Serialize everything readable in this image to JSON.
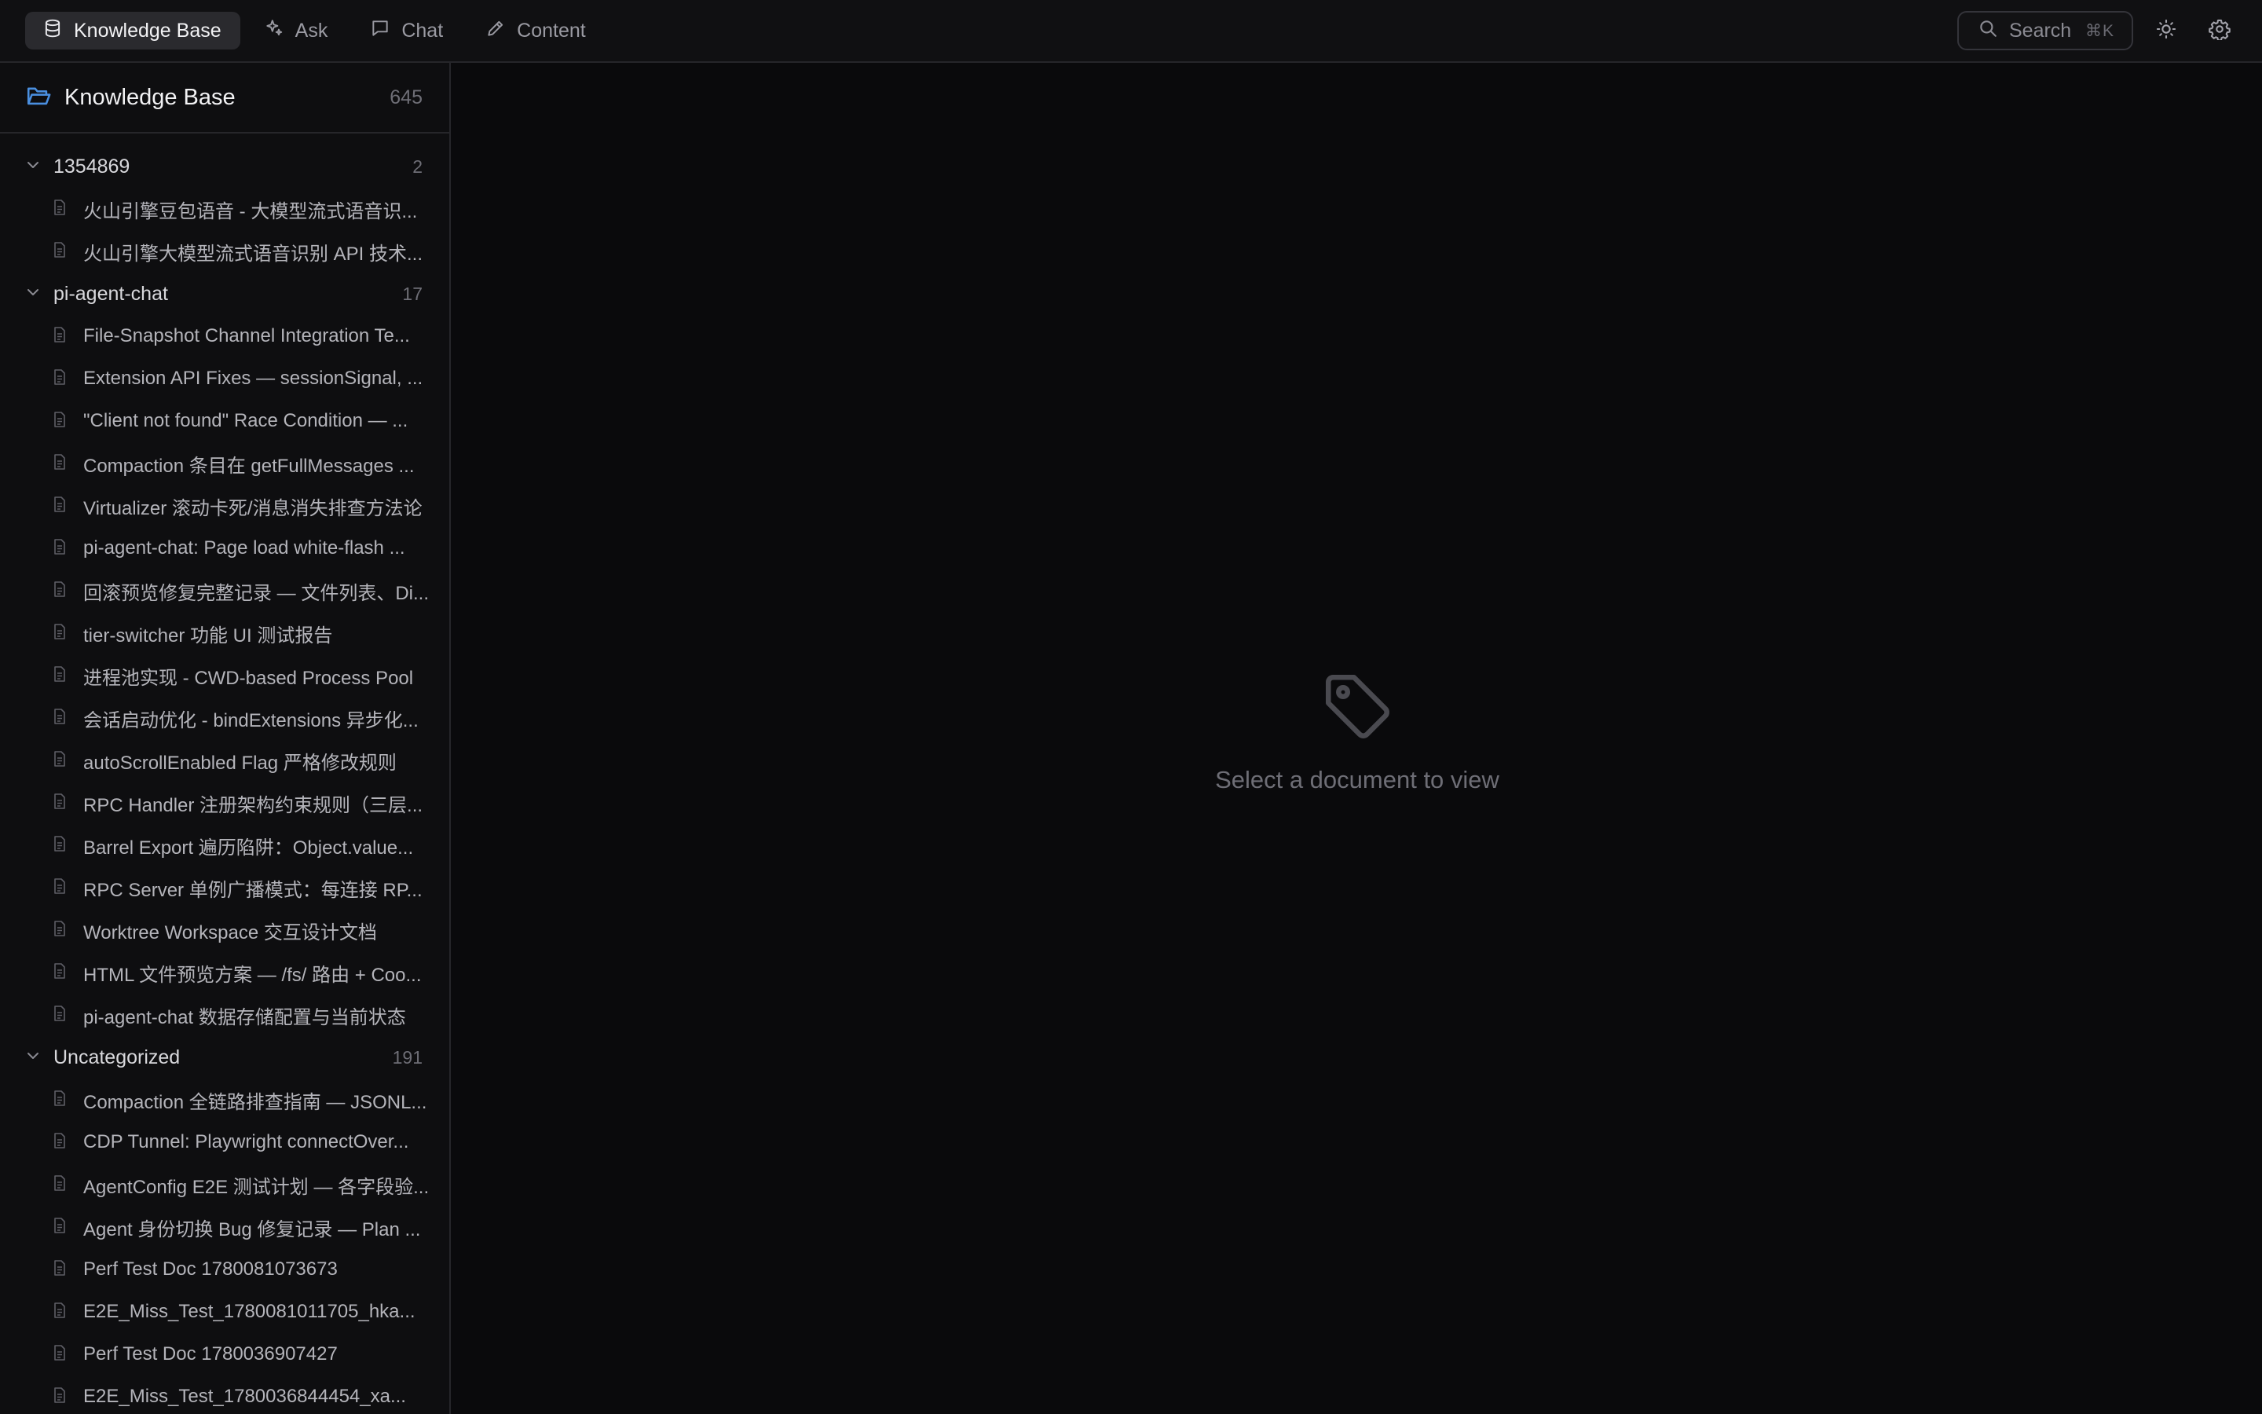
{
  "topbar": {
    "tabs": [
      {
        "label": "Knowledge Base",
        "icon": "database-icon",
        "active": true
      },
      {
        "label": "Ask",
        "icon": "sparkles-icon",
        "active": false
      },
      {
        "label": "Chat",
        "icon": "chat-bubble-icon",
        "active": false
      },
      {
        "label": "Content",
        "icon": "pencil-icon",
        "active": false
      }
    ],
    "search": {
      "label": "Search",
      "shortcut": "⌘K"
    },
    "theme_toggle_icon": "sun-icon",
    "settings_icon": "gear-icon"
  },
  "sidebar": {
    "title": "Knowledge Base",
    "count": "645",
    "groups": [
      {
        "name": "1354869",
        "count": "2",
        "docs": [
          "火山引擎豆包语音 - 大模型流式语音识...",
          "火山引擎大模型流式语音识别 API 技术..."
        ]
      },
      {
        "name": "pi-agent-chat",
        "count": "17",
        "docs": [
          "File-Snapshot Channel Integration Te...",
          "Extension API Fixes — sessionSignal, ...",
          "\"Client not found\" Race Condition — ...",
          "Compaction 条目在 getFullMessages ...",
          "Virtualizer 滚动卡死/消息消失排查方法论",
          "pi-agent-chat: Page load white-flash ...",
          "回滚预览修复完整记录 — 文件列表、Di...",
          "tier-switcher 功能 UI 测试报告",
          "进程池实现 - CWD-based Process Pool",
          "会话启动优化 - bindExtensions 异步化...",
          "autoScrollEnabled Flag 严格修改规则",
          "RPC Handler 注册架构约束规则（三层...",
          "Barrel Export 遍历陷阱：Object.value...",
          "RPC Server 单例广播模式：每连接 RP...",
          "Worktree Workspace 交互设计文档",
          "HTML 文件预览方案 — /fs/ 路由 + Coo...",
          "pi-agent-chat 数据存储配置与当前状态"
        ]
      },
      {
        "name": "Uncategorized",
        "count": "191",
        "docs": [
          "Compaction 全链路排查指南 — JSONL...",
          "CDP Tunnel: Playwright connectOver...",
          "AgentConfig E2E 测试计划 — 各字段验...",
          "Agent 身份切换 Bug 修复记录 — Plan ...",
          "Perf Test Doc 1780081073673",
          "E2E_Miss_Test_1780081011705_hka...",
          "Perf Test Doc 1780036907427",
          "E2E_Miss_Test_1780036844454_xa..."
        ]
      }
    ]
  },
  "main": {
    "empty_icon": "tag-icon",
    "empty_text": "Select a document to view"
  },
  "colors": {
    "background": "#0a0a0c",
    "panel": "#0e0e10",
    "accent_blue": "#4a8fe0",
    "active_tab": "#2a2a2e"
  }
}
